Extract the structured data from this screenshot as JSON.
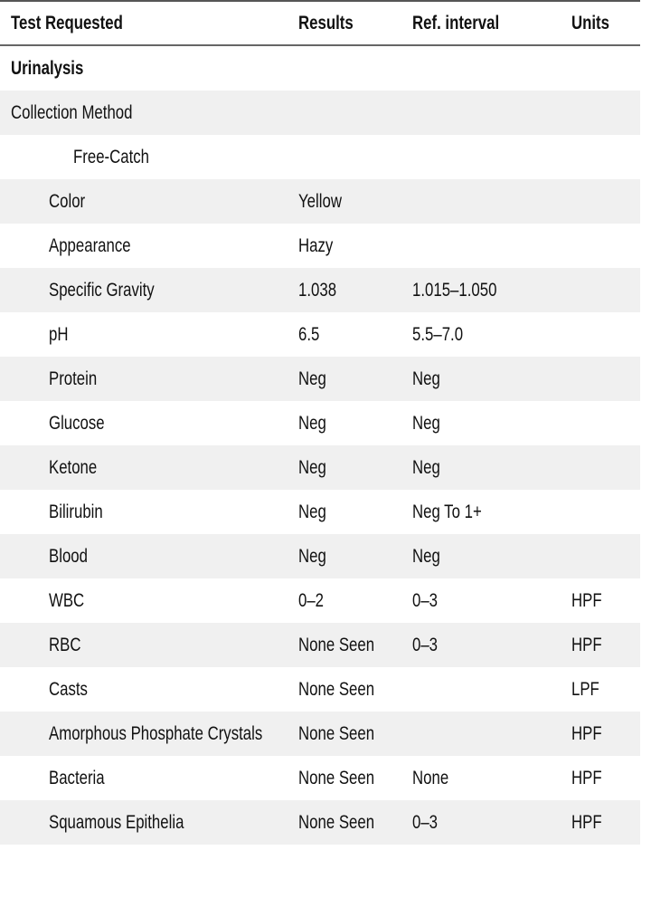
{
  "columns": {
    "test": "Test Requested",
    "results": "Results",
    "ref": "Ref. interval",
    "units": "Units"
  },
  "section_title": "Urinalysis",
  "collection": {
    "label": "Collection Method",
    "value": "Free-Catch"
  },
  "rows": [
    {
      "test": "Color",
      "result": "Yellow",
      "ref": "",
      "units": ""
    },
    {
      "test": "Appearance",
      "result": "Hazy",
      "ref": "",
      "units": ""
    },
    {
      "test": "Specific Gravity",
      "result": "1.038",
      "ref": "1.015–1.050",
      "units": ""
    },
    {
      "test": "pH",
      "result": "6.5",
      "ref": "5.5–7.0",
      "units": ""
    },
    {
      "test": "Protein",
      "result": "Neg",
      "ref": "Neg",
      "units": ""
    },
    {
      "test": "Glucose",
      "result": "Neg",
      "ref": "Neg",
      "units": ""
    },
    {
      "test": "Ketone",
      "result": "Neg",
      "ref": "Neg",
      "units": ""
    },
    {
      "test": "Bilirubin",
      "result": "Neg",
      "ref": "Neg To 1+",
      "units": ""
    },
    {
      "test": "Blood",
      "result": "Neg",
      "ref": "Neg",
      "units": ""
    },
    {
      "test": "WBC",
      "result": "0–2",
      "ref": "0–3",
      "units": "HPF"
    },
    {
      "test": "RBC",
      "result": "None Seen",
      "ref": "0–3",
      "units": "HPF"
    },
    {
      "test": "Casts",
      "result": "None Seen",
      "ref": "",
      "units": "LPF"
    },
    {
      "test": "Amorphous Phosphate Crystals",
      "result": "None Seen",
      "ref": "",
      "units": "HPF"
    },
    {
      "test": "Bacteria",
      "result": "None Seen",
      "ref": "None",
      "units": "HPF"
    },
    {
      "test": "Squamous Epithelia",
      "result": "None Seen",
      "ref": "0–3",
      "units": "HPF"
    }
  ],
  "colors": {
    "row_shade": "#f0f0f0",
    "rule": "#555555",
    "text": "#111111"
  }
}
